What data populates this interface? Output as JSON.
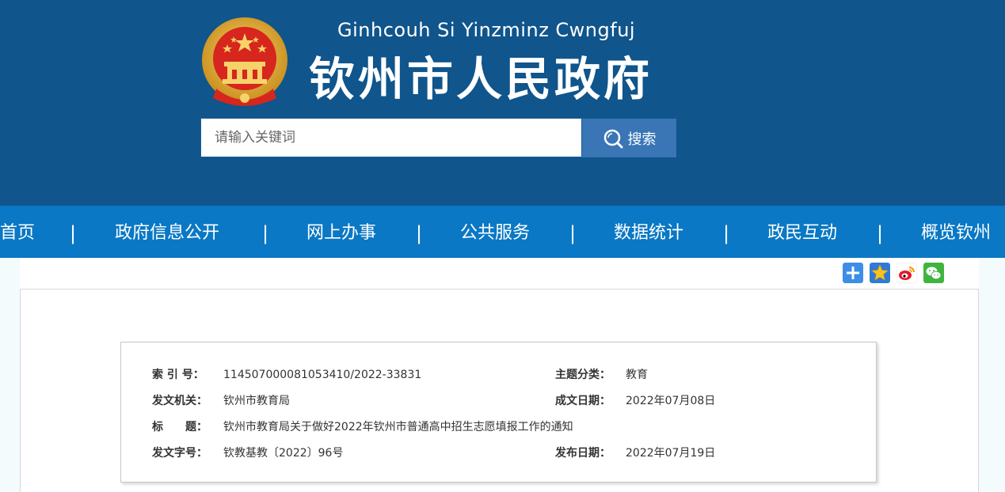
{
  "header": {
    "subtitle": "Ginhcouh Si Yinzminz Cwngfuj",
    "title": "钦州市人民政府",
    "emblem_icon": "national-emblem-icon"
  },
  "search": {
    "placeholder": "请输入关键词",
    "button_label": "搜索",
    "icon": "search-icon"
  },
  "nav": {
    "items": [
      {
        "label": "首页"
      },
      {
        "label": "政府信息公开"
      },
      {
        "label": "网上办事"
      },
      {
        "label": "公共服务"
      },
      {
        "label": "数据统计"
      },
      {
        "label": "政民互动"
      },
      {
        "label": "概览钦州"
      }
    ],
    "separator": "|"
  },
  "share": {
    "icons": [
      "plus-share-icon",
      "favorite-star-icon",
      "weibo-icon",
      "wechat-icon"
    ]
  },
  "info": {
    "index_label": "索 引 号：",
    "index_value": "114507000081053410/2022-33831",
    "topic_label": "主题分类：",
    "topic_value": "教育",
    "issuer_label": "发文机关：",
    "issuer_value": "钦州市教育局",
    "created_label": "成文日期：",
    "created_value": "2022年07月08日",
    "title_label": "标　　题：",
    "title_value": "钦州市教育局关于做好2022年钦州市普通高中招生志愿填报工作的通知",
    "docno_label": "发文字号：",
    "docno_value": "钦教基教〔2022〕96号",
    "published_label": "发布日期：",
    "published_value": "2022年07月19日"
  },
  "colors": {
    "header_bg": "#10558c",
    "nav_bg": "#0a78c4",
    "search_button_bg": "#3a76b6",
    "emblem_gold": "#e2b13c",
    "emblem_red": "#d7261e"
  }
}
